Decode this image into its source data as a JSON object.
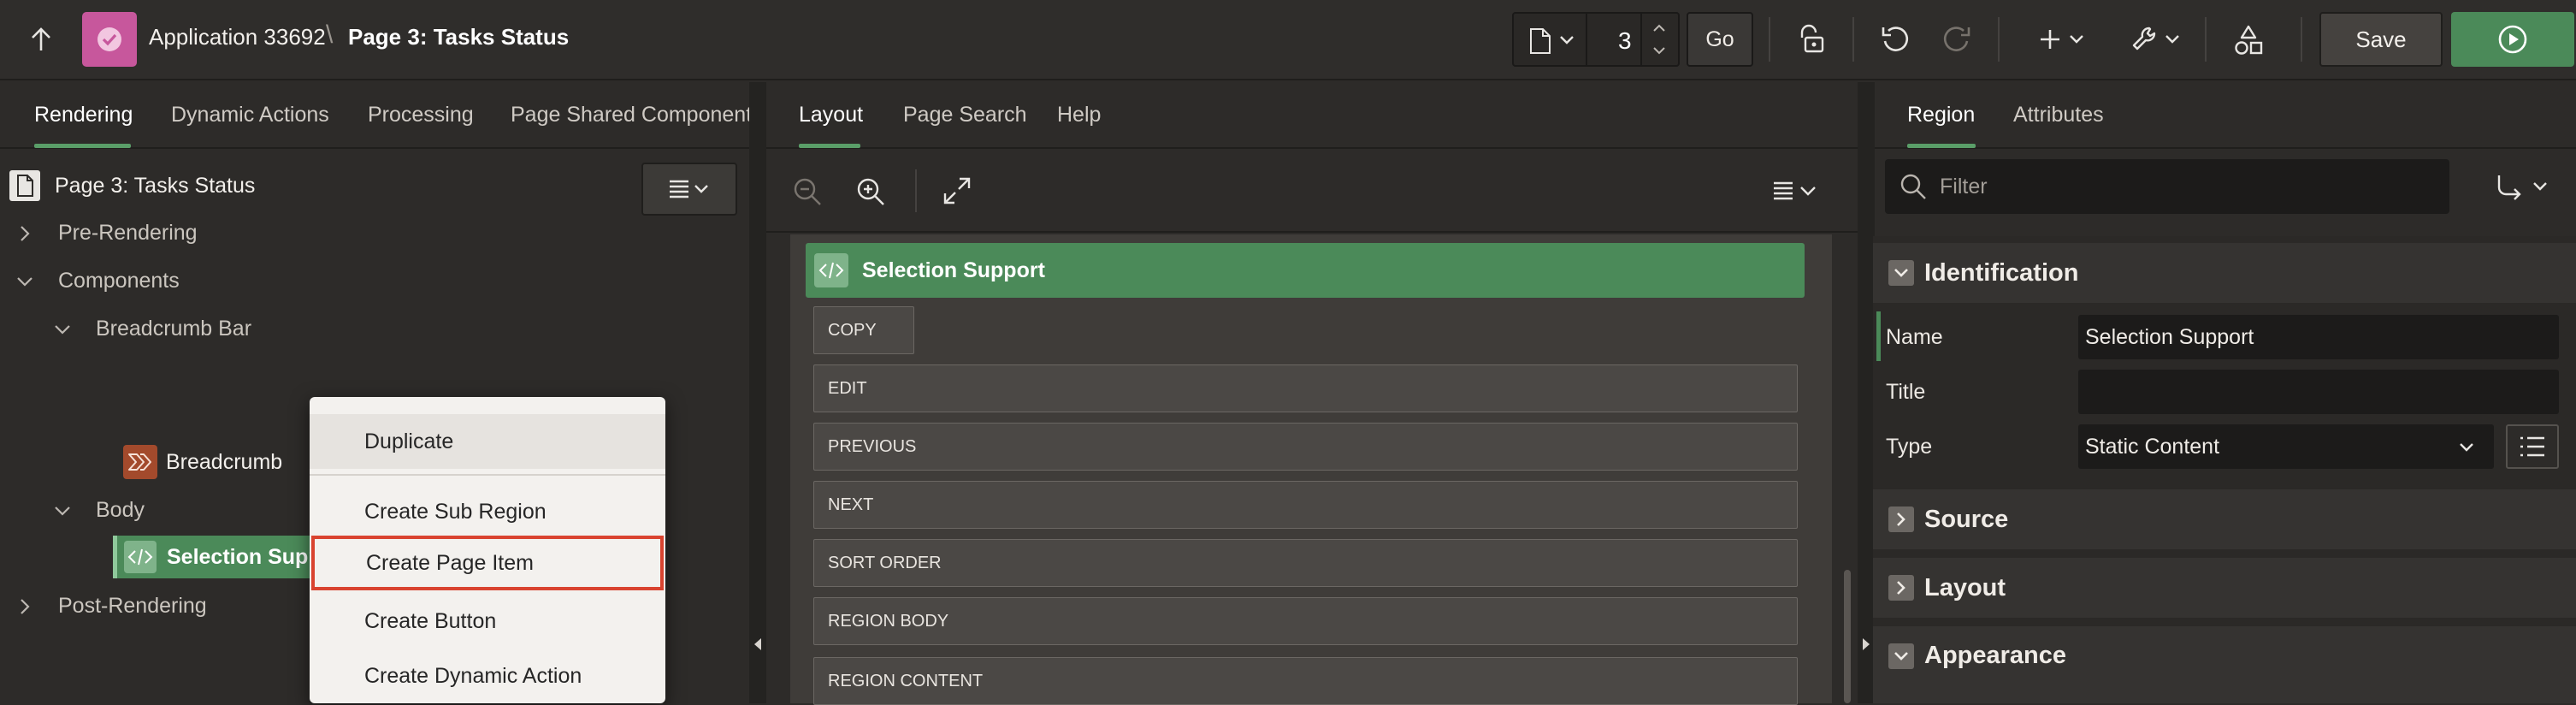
{
  "header": {
    "app_name": "Application 33692",
    "separator": "\\",
    "page_name": "Page 3: Tasks Status",
    "page_number": "3",
    "go_label": "Go",
    "save_label": "Save",
    "colors": {
      "app_icon": "#c7579c",
      "run": "#4b8a59"
    }
  },
  "left": {
    "tabs": [
      "Rendering",
      "Dynamic Actions",
      "Processing",
      "Page Shared Components"
    ],
    "page_title": "Page 3: Tasks Status",
    "tree": {
      "pre_rendering": "Pre-Rendering",
      "components": "Components",
      "breadcrumb_bar": "Breadcrumb Bar",
      "breadcrumb": "Breadcrumb",
      "body": "Body",
      "selection_support": "Selection Supp",
      "post_rendering": "Post-Rendering"
    }
  },
  "context_menu": {
    "items": [
      "Duplicate",
      "Create Sub Region",
      "Create Page Item",
      "Create Button",
      "Create Dynamic Action"
    ],
    "highlighted": "Create Page Item",
    "highlight_color": "#d9432f"
  },
  "center": {
    "tabs": [
      "Layout",
      "Page Search",
      "Help"
    ],
    "region_title": "Selection Support",
    "slots": [
      "COPY",
      "EDIT",
      "PREVIOUS",
      "NEXT",
      "SORT ORDER",
      "REGION BODY",
      "REGION CONTENT"
    ]
  },
  "right": {
    "tabs": [
      "Region",
      "Attributes"
    ],
    "filter_placeholder": "Filter",
    "sections": {
      "identification": "Identification",
      "source": "Source",
      "layout": "Layout",
      "appearance": "Appearance"
    },
    "props": {
      "name_label": "Name",
      "name_value": "Selection Support",
      "title_label": "Title",
      "title_value": "",
      "type_label": "Type",
      "type_value": "Static Content"
    }
  }
}
